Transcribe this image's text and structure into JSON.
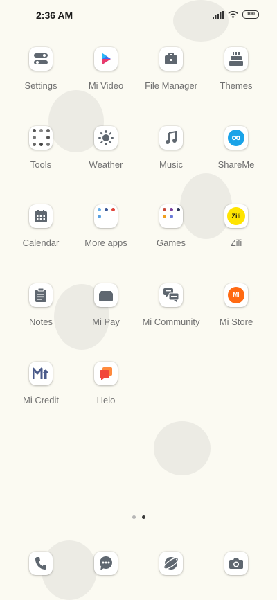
{
  "status_bar": {
    "time": "2:36 AM",
    "battery": "100"
  },
  "apps": [
    {
      "label": "Settings",
      "icon": "settings-icon"
    },
    {
      "label": "Mi Video",
      "icon": "play-icon"
    },
    {
      "label": "File Manager",
      "icon": "briefcase-icon"
    },
    {
      "label": "Themes",
      "icon": "cake-icon"
    },
    {
      "label": "Tools",
      "icon": "folder-icon"
    },
    {
      "label": "Weather",
      "icon": "sun-icon"
    },
    {
      "label": "Music",
      "icon": "music-note-icon"
    },
    {
      "label": "ShareMe",
      "icon": "infinity-icon"
    },
    {
      "label": "Calendar",
      "icon": "calendar-icon"
    },
    {
      "label": "More apps",
      "icon": "folder-icon"
    },
    {
      "label": "Games",
      "icon": "folder-icon"
    },
    {
      "label": "Zili",
      "icon": "zili-icon",
      "icon_text": "Zili"
    },
    {
      "label": "Notes",
      "icon": "clipboard-icon"
    },
    {
      "label": "Mi Pay",
      "icon": "wallet-icon"
    },
    {
      "label": "Mi Community",
      "icon": "chat-bubbles-icon"
    },
    {
      "label": "Mi Store",
      "icon": "mi-store-icon",
      "icon_text": "MI"
    },
    {
      "label": "Mi Credit",
      "icon": "mi-credit-icon"
    },
    {
      "label": "Helo",
      "icon": "helo-icon"
    }
  ],
  "page_indicator": {
    "count": 2,
    "active": 1
  },
  "dock": [
    {
      "icon": "phone-icon"
    },
    {
      "icon": "messages-icon"
    },
    {
      "icon": "browser-icon"
    },
    {
      "icon": "camera-icon"
    }
  ],
  "colors": {
    "background": "#fbfaf2",
    "icon_gray": "#5f6770",
    "shareme_blue": "#1aa3e8",
    "mi_orange": "#ff6a13",
    "zili_yellow": "#ffe400",
    "helo_red": "#f1483b"
  }
}
